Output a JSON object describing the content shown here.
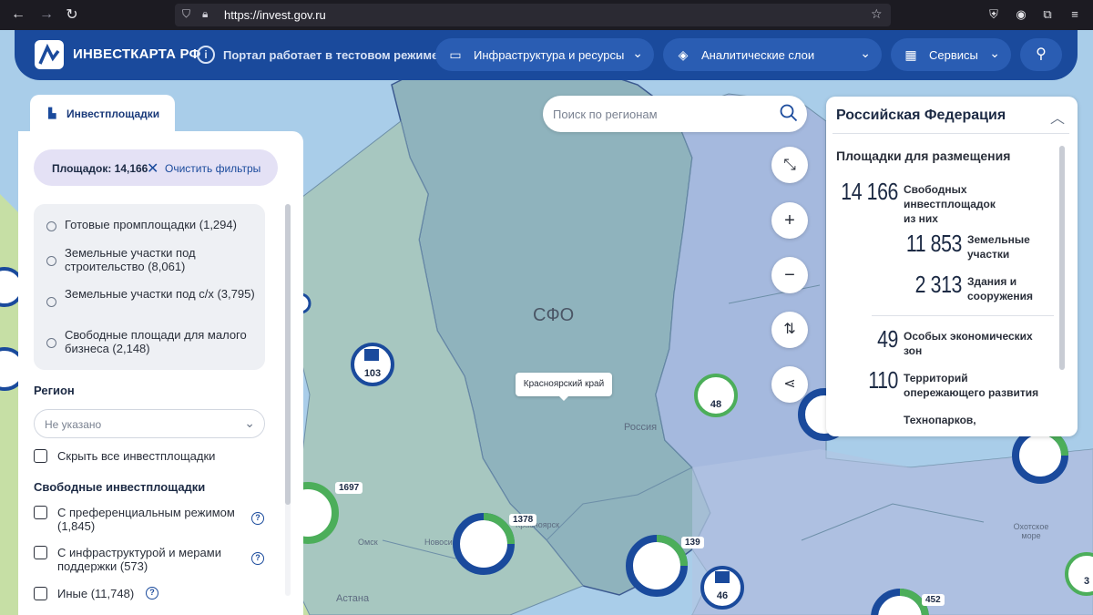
{
  "browser": {
    "url": "https://invest.gov.ru"
  },
  "header": {
    "logo_text": "ИНВЕСТКАРТА РФ",
    "info_text": "Портал работает в тестовом режиме",
    "menu": [
      {
        "label": "Инфраструктура и ресурсы",
        "icon": "briefcase-icon"
      },
      {
        "label": "Аналитические слои",
        "icon": "layers-icon"
      },
      {
        "label": "Сервисы",
        "icon": "grid-icon"
      }
    ],
    "user_icon": "user-icon"
  },
  "left_panel": {
    "tab_label": "Инвестплощадки",
    "filter_count": "Площадок: 14,166",
    "clear_filters": "Очистить фильтры",
    "radio_options": [
      "Готовые промплощадки (1,294)",
      "Земельные участки под строительство (8,061)",
      "Земельные участки под с/х (3,795)",
      "Свободные площади для малого бизнеса (2,148)"
    ],
    "region_title": "Регион",
    "region_placeholder": "Не указано",
    "hide_all": "Скрыть все инвестплощадки",
    "free_title": "Свободные инвестплощадки",
    "free_options": [
      "С преференциальным режимом (1,845)",
      "С инфраструктурой и мерами поддержки (573)",
      "Иные (11,748)"
    ]
  },
  "search": {
    "placeholder": "Поиск по регионам"
  },
  "right_panel": {
    "title": "Российская Федерация",
    "subtitle": "Площадки для размещения",
    "stats": [
      {
        "num": "14 166",
        "label": "Свободных инвестплощадок"
      },
      {
        "num": "",
        "label": "из них"
      },
      {
        "num": "11 853",
        "label": "Земельные участки"
      },
      {
        "num": "2 313",
        "label": "Здания и сооружения"
      },
      {
        "num": "49",
        "label": "Особых экономических зон"
      },
      {
        "num": "110",
        "label": "Территорий опережающего развития"
      },
      {
        "num": "",
        "label": "Технопарков,"
      }
    ]
  },
  "map": {
    "region_label": "СФО",
    "tooltip": "Красноярский край",
    "labels": [
      "Россия",
      "Омск",
      "Новосибирск",
      "Красноярск",
      "Астана",
      "Охотское море"
    ],
    "clusters": [
      "103",
      "48",
      "1697",
      "1378",
      "139",
      "46",
      "452",
      "3"
    ]
  }
}
